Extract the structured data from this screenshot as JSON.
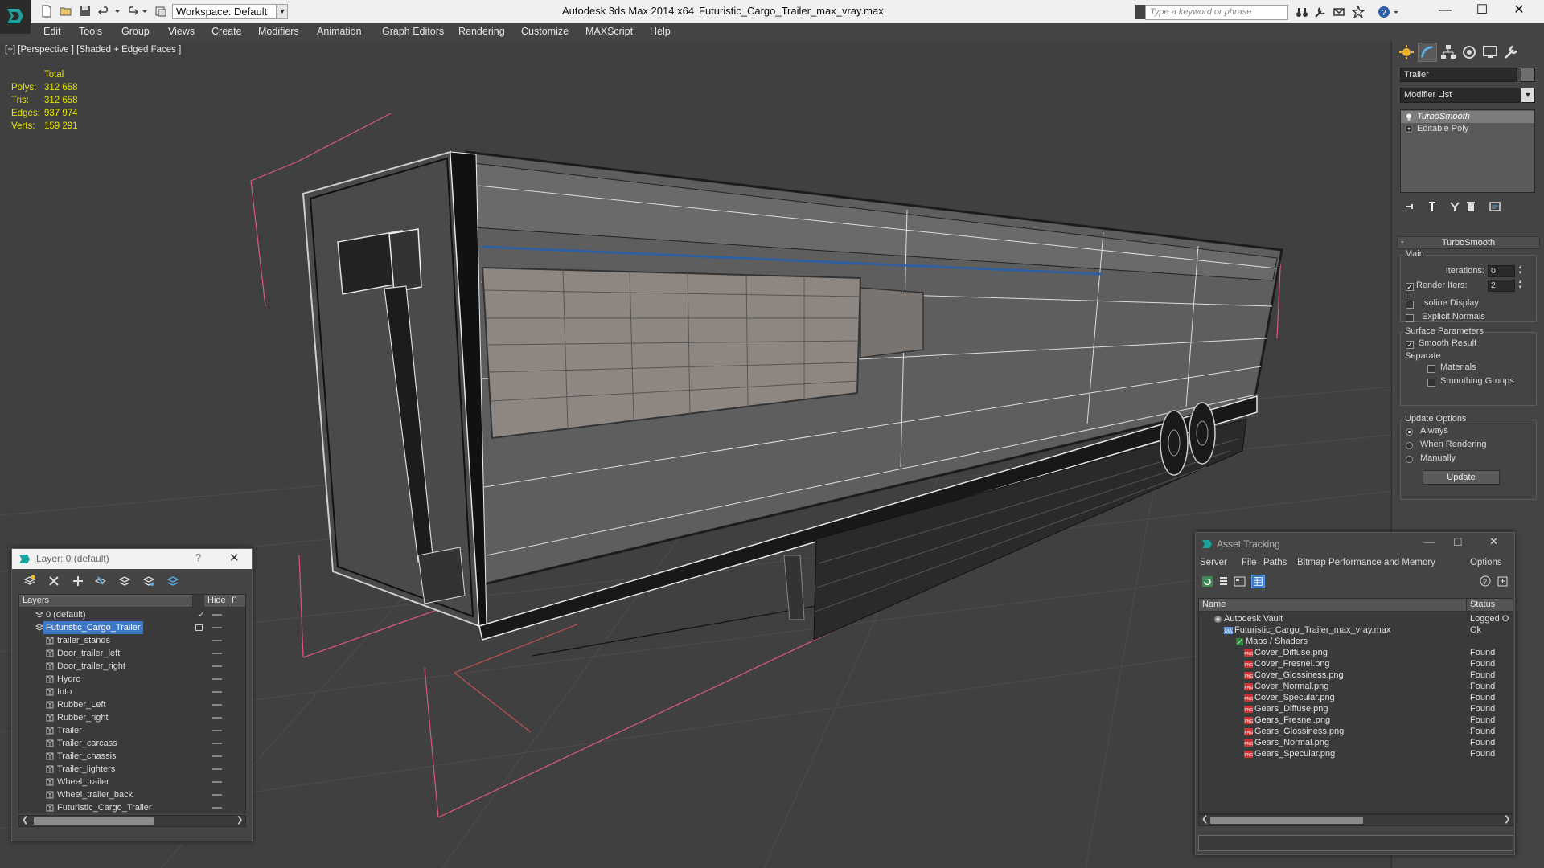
{
  "titlebar": {
    "workspace": "Workspace: Default",
    "app_title": "Autodesk 3ds Max  2014 x64",
    "file_title": "Futuristic_Cargo_Trailer_max_vray.max",
    "search_placeholder": "Type a keyword or phrase",
    "minimize": "—",
    "maximize": "☐",
    "close": "✕"
  },
  "menu": [
    "Edit",
    "Tools",
    "Group",
    "Views",
    "Create",
    "Modifiers",
    "Animation",
    "Graph Editors",
    "Rendering",
    "Customize",
    "MAXScript",
    "Help"
  ],
  "viewport": {
    "label": "[+] [Perspective ] [Shaded + Edged Faces ]",
    "stats": {
      "header": "Total",
      "rows": [
        {
          "label": "Polys:",
          "value": "312 658"
        },
        {
          "label": "Tris:",
          "value": "312 658"
        },
        {
          "label": "Edges:",
          "value": "937 974"
        },
        {
          "label": "Verts:",
          "value": "159 291"
        }
      ]
    }
  },
  "command_panel": {
    "object_name": "Trailer",
    "modifier_list": "Modifier List",
    "stack": [
      "TurboSmooth",
      "Editable Poly"
    ],
    "rollout_title": "TurboSmooth",
    "main_label": "Main",
    "iterations_label": "Iterations:",
    "iterations_value": "0",
    "render_iters_label": "Render Iters:",
    "render_iters_value": "2",
    "render_iters_checked": "✓",
    "isoline_label": "Isoline Display",
    "explicit_normals_label": "Explicit Normals",
    "surface_params_label": "Surface Parameters",
    "smooth_result_label": "Smooth Result",
    "smooth_result_checked": "✓",
    "separate_label": "Separate",
    "materials_label": "Materials",
    "smoothing_groups_label": "Smoothing Groups",
    "update_options_label": "Update Options",
    "always_label": "Always",
    "when_rendering_label": "When Rendering",
    "manually_label": "Manually",
    "update_button": "Update"
  },
  "layer_dialog": {
    "title": "Layer: 0 (default)",
    "help": "?",
    "close": "✕",
    "columns": [
      "Layers",
      "Hide",
      "F"
    ],
    "default_layer": "0 (default)",
    "default_tick": "✓",
    "selected_layer": "Futuristic_Cargo_Trailer",
    "objects": [
      "trailer_stands",
      "Door_trailer_left",
      "Door_trailer_right",
      "Hydro",
      "Into",
      "Rubber_Left",
      "Rubber_right",
      "Trailer",
      "Trailer_carcass",
      "Trailer_chassis",
      "Trailer_lighters",
      "Wheel_trailer",
      "Wheel_trailer_back",
      "Futuristic_Cargo_Trailer"
    ],
    "scroll_left": "❮",
    "scroll_right": "❯"
  },
  "asset_dialog": {
    "title": "Asset Tracking",
    "minimize": "—",
    "maximize": "☐",
    "close": "✕",
    "menu": [
      "Server",
      "File",
      "Paths",
      "Bitmap Performance and Memory",
      "Options"
    ],
    "columns": [
      "Name",
      "Status"
    ],
    "vault": {
      "name": "Autodesk Vault",
      "status": "Logged O"
    },
    "file": {
      "name": "Futuristic_Cargo_Trailer_max_vray.max",
      "status": "Ok"
    },
    "folder": "Maps / Shaders",
    "maps": [
      {
        "name": "Cover_Diffuse.png",
        "status": "Found"
      },
      {
        "name": "Cover_Fresnel.png",
        "status": "Found"
      },
      {
        "name": "Cover_Glossiness.png",
        "status": "Found"
      },
      {
        "name": "Cover_Normal.png",
        "status": "Found"
      },
      {
        "name": "Cover_Specular.png",
        "status": "Found"
      },
      {
        "name": "Gears_Diffuse.png",
        "status": "Found"
      },
      {
        "name": "Gears_Fresnel.png",
        "status": "Found"
      },
      {
        "name": "Gears_Glossiness.png",
        "status": "Found"
      },
      {
        "name": "Gears_Normal.png",
        "status": "Found"
      },
      {
        "name": "Gears_Specular.png",
        "status": "Found"
      }
    ],
    "scroll_left": "❮",
    "scroll_right": "❯"
  },
  "colors": {
    "ui_dark": "#444444",
    "viewport_bg": "#404040",
    "selection_blue": "#3d78c9",
    "stats_yellow": "#e4e400",
    "grid_pink": "#d85a7a"
  }
}
